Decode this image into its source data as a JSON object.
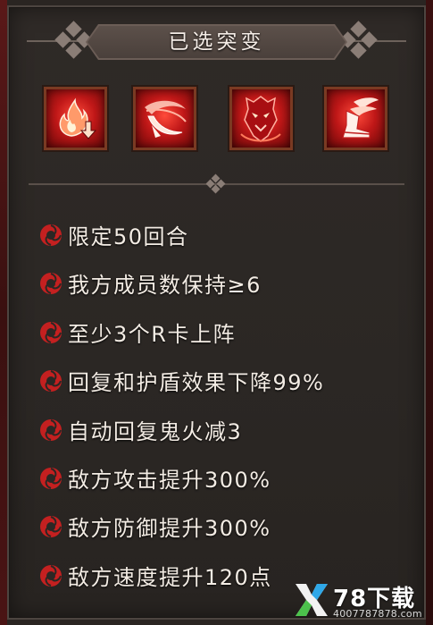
{
  "header": {
    "title": "已选突变"
  },
  "mutations": [
    {
      "icon": "flame-down-arrow-icon"
    },
    {
      "icon": "crescent-blade-icon"
    },
    {
      "icon": "demon-shield-icon"
    },
    {
      "icon": "winged-boot-icon"
    }
  ],
  "conditions": [
    {
      "text": "限定50回合"
    },
    {
      "text": "我方成员数保持≥6"
    },
    {
      "text": "至少3个R卡上阵"
    },
    {
      "text": "回复和护盾效果下降99%"
    },
    {
      "text": "自动回复鬼火减3"
    },
    {
      "text": "敌方攻击提升300%"
    },
    {
      "text": "敌方防御提升300%"
    },
    {
      "text": "敌方速度提升120点"
    }
  ],
  "watermark": {
    "brand": "78下载",
    "url": "40077878​78.com"
  },
  "colors": {
    "panel_bg": "#2b2724",
    "banner": "#5c504a",
    "text": "#f3ece4",
    "icon_red": "#c01818",
    "bullet_red": "#c42020"
  }
}
